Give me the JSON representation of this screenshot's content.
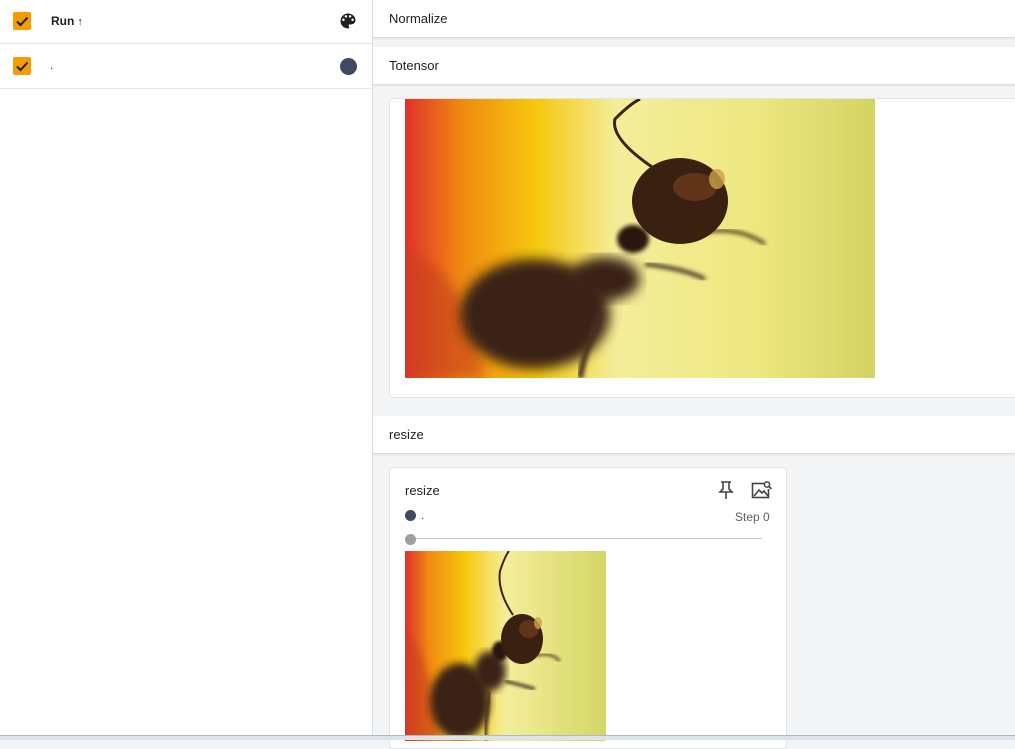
{
  "runs": {
    "header": {
      "label": "Run",
      "sort_indicator": "↑"
    },
    "items": [
      {
        "name": ".",
        "color": "#3f4a60",
        "checked": true
      }
    ],
    "accent_color": "#f59d00"
  },
  "groups": [
    {
      "title": "Normalize"
    },
    {
      "title": "Totensor"
    },
    {
      "title": "resize"
    }
  ],
  "resize_card": {
    "title": "resize",
    "run_name": ".",
    "step_label": "Step 0",
    "slider_value": 0
  },
  "icons": {
    "palette": "palette-icon",
    "pin": "pin-icon",
    "zoom": "image-search-icon"
  }
}
